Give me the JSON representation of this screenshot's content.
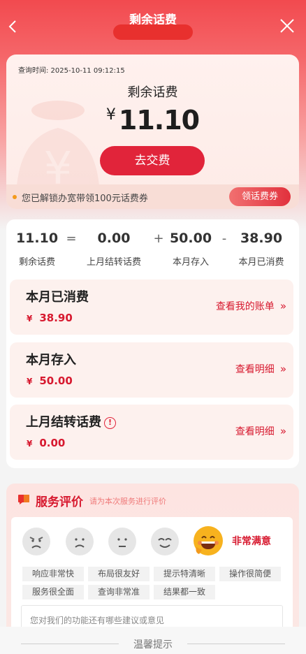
{
  "nav": {
    "title": "剩余话费",
    "back_icon": "chevron-left-icon",
    "close_icon": "close-icon"
  },
  "balance": {
    "query_time": "查询时间: 2025-10-11 09:12:15",
    "label": "剩余话费",
    "currency": "¥",
    "amount": "11.10",
    "pay_button": "去交费",
    "promo_text": "您已解锁办宽带领100元话费券",
    "promo_button": "领话费券"
  },
  "equation": {
    "values": [
      "11.10",
      "0.00",
      "50.00",
      "38.90"
    ],
    "operators": [
      "=",
      "+",
      "-"
    ],
    "labels": [
      "剩余话费",
      "上月结转话费",
      "本月存入",
      "本月已消费"
    ]
  },
  "items": [
    {
      "title": "本月已消费",
      "currency": "¥",
      "amount": "38.90",
      "link": "查看我的账单",
      "arrow": "»"
    },
    {
      "title": "本月存入",
      "currency": "¥",
      "amount": "50.00",
      "link": "查看明细",
      "arrow": "»"
    },
    {
      "title": "上月结转话费",
      "warn": "!",
      "currency": "¥",
      "amount": "0.00",
      "link": "查看明细",
      "arrow": "»"
    }
  ],
  "evaluation": {
    "title": "服务评价",
    "subtitle": "请为本次服务进行评价",
    "faces": [
      "angry-face-icon",
      "sad-face-icon",
      "neutral-face-icon",
      "smile-face-icon",
      "grin-face-icon"
    ],
    "selected_label": "非常满意",
    "tags": [
      "响应非常快",
      "布局很友好",
      "提示特清晰",
      "操作很简便",
      "服务很全面",
      "查询非常准",
      "结果都一致"
    ],
    "comment_placeholder": "您对我们的功能还有哪些建议或意见"
  },
  "footer": {
    "text": "温馨提示"
  },
  "colors": {
    "brand_red": "#e1243a",
    "accent_text": "#d7192f",
    "header_red": "#f24a4f"
  }
}
